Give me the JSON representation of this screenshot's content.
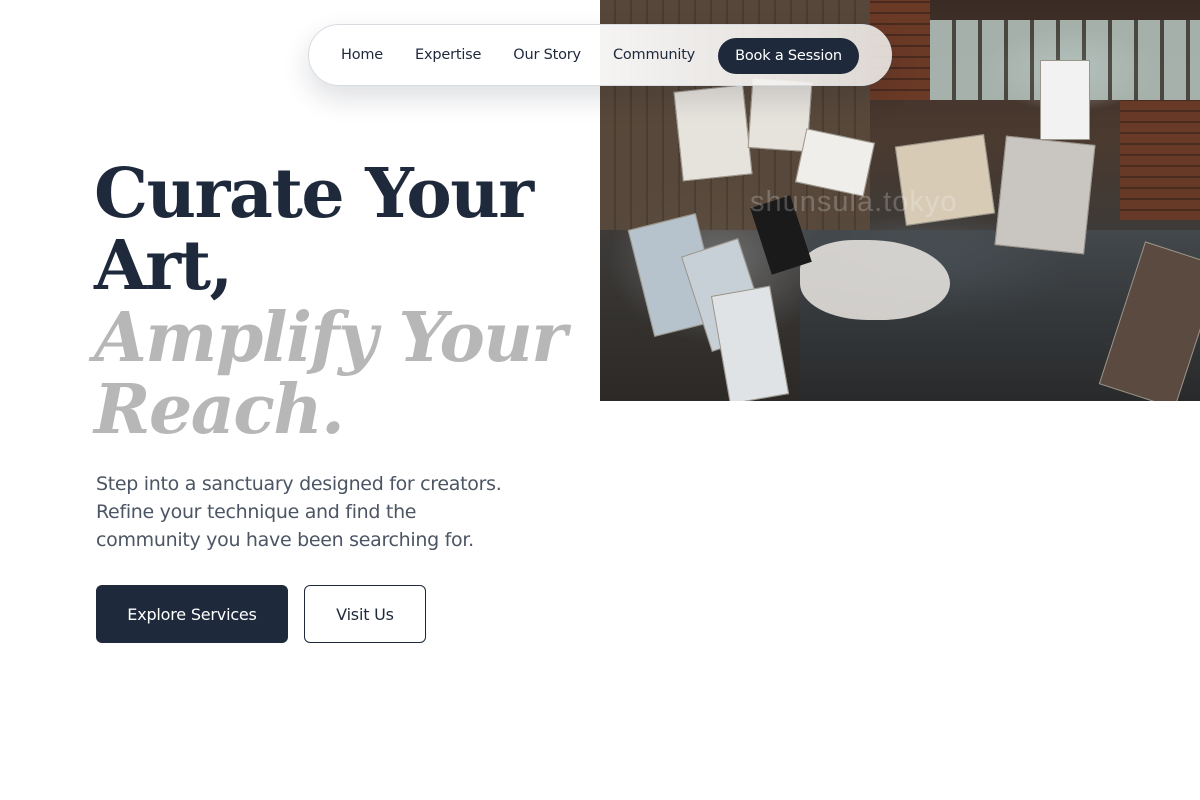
{
  "nav": {
    "links": [
      "Home",
      "Expertise",
      "Our Story",
      "Community"
    ],
    "cta_label": "Book a Session"
  },
  "hero": {
    "title_line1": "Curate Your",
    "title_line2": "Art,",
    "accent_line1": "Amplify Your",
    "accent_line2": "Reach.",
    "subtitle": "Step into a sanctuary designed for creators. Refine your technique and find the community you have been searching for.",
    "primary_button": "Explore Services",
    "secondary_button": "Visit Us",
    "image_watermark": "shunsula.tokyo"
  },
  "colors": {
    "primary": "#1e293b",
    "accent_text": "#b7b7b7",
    "body_text": "#4b5563",
    "background": "#ffffff"
  },
  "icons": []
}
